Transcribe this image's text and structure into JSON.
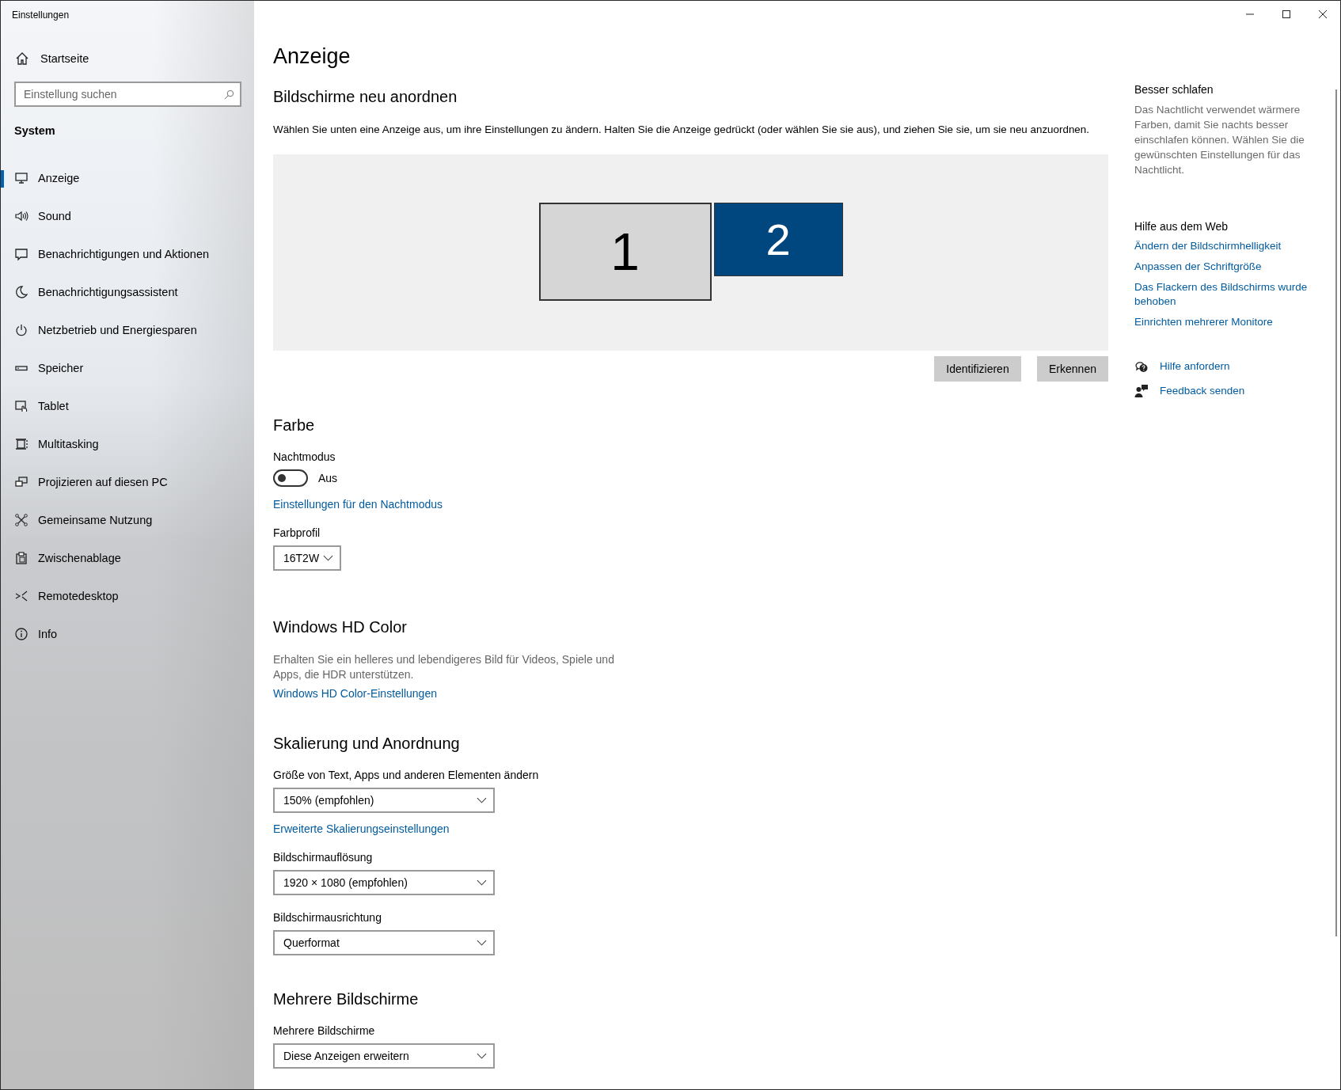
{
  "window": {
    "title": "Einstellungen"
  },
  "sidebar": {
    "home": "Startseite",
    "search": {
      "placeholder": "Einstellung suchen"
    },
    "section": "System",
    "items": [
      {
        "label": "Anzeige",
        "selected": true
      },
      {
        "label": "Sound",
        "selected": false
      },
      {
        "label": "Benachrichtigungen und Aktionen",
        "selected": false
      },
      {
        "label": "Benachrichtigungsassistent",
        "selected": false
      },
      {
        "label": "Netzbetrieb und Energiesparen",
        "selected": false
      },
      {
        "label": "Speicher",
        "selected": false
      },
      {
        "label": "Tablet",
        "selected": false
      },
      {
        "label": "Multitasking",
        "selected": false
      },
      {
        "label": "Projizieren auf diesen PC",
        "selected": false
      },
      {
        "label": "Gemeinsame Nutzung",
        "selected": false
      },
      {
        "label": "Zwischenablage",
        "selected": false
      },
      {
        "label": "Remotedesktop",
        "selected": false
      },
      {
        "label": "Info",
        "selected": false
      }
    ]
  },
  "page": {
    "title": "Anzeige",
    "arrange": {
      "heading": "Bildschirme neu anordnen",
      "description": "Wählen Sie unten eine Anzeige aus, um ihre Einstellungen zu ändern. Halten Sie die Anzeige gedrückt (oder wählen Sie sie aus), und ziehen Sie sie, um sie neu anzuordnen.",
      "monitors": [
        {
          "label": "1",
          "selected": false
        },
        {
          "label": "2",
          "selected": true
        }
      ],
      "buttons": [
        "Identifizieren",
        "Erkennen"
      ]
    },
    "color": {
      "heading": "Farbe",
      "night_mode": {
        "label": "Nachtmodus",
        "on": false,
        "state_text": "Aus"
      },
      "link": "Einstellungen für den Nachtmodus",
      "profile": {
        "label": "Farbprofil",
        "value": "16T2W"
      }
    },
    "hdr": {
      "heading": "Windows HD Color",
      "description": "Erhalten Sie ein helleres und lebendigeres Bild für Videos, Spiele und Apps, die HDR unterstützen.",
      "link": "Windows HD Color-Einstellungen"
    },
    "scaling": {
      "heading": "Skalierung und Anordnung",
      "items": [
        {
          "kind": "dropdown",
          "label": "Größe von Text, Apps und anderen Elementen ändern",
          "value": "150% (empfohlen)"
        },
        {
          "kind": "link",
          "text": "Erweiterte Skalierungseinstellungen"
        },
        {
          "kind": "dropdown",
          "label": "Bildschirmauflösung",
          "value": "1920 × 1080 (empfohlen)"
        },
        {
          "kind": "dropdown",
          "label": "Bildschirmausrichtung",
          "value": "Querformat"
        }
      ]
    },
    "multiple": {
      "heading": "Mehrere Bildschirme",
      "label": "Mehrere Bildschirme",
      "value": "Diese Anzeigen erweitern"
    }
  },
  "aside": {
    "sleep": {
      "heading": "Besser schlafen",
      "text": "Das Nachtlicht verwendet wärmere Farben, damit Sie nachts besser einschlafen können. Wählen Sie die gewünschten Einstellungen für das Nachtlicht."
    },
    "web": {
      "heading": "Hilfe aus dem Web",
      "links": [
        "Ändern der Bildschirmhelligkeit",
        "Anpassen der Schriftgröße",
        "Das Flackern des Bildschirms wurde behoben",
        "Einrichten mehrerer Monitore"
      ]
    },
    "actions": [
      "Hilfe anfordern",
      "Feedback senden"
    ]
  }
}
